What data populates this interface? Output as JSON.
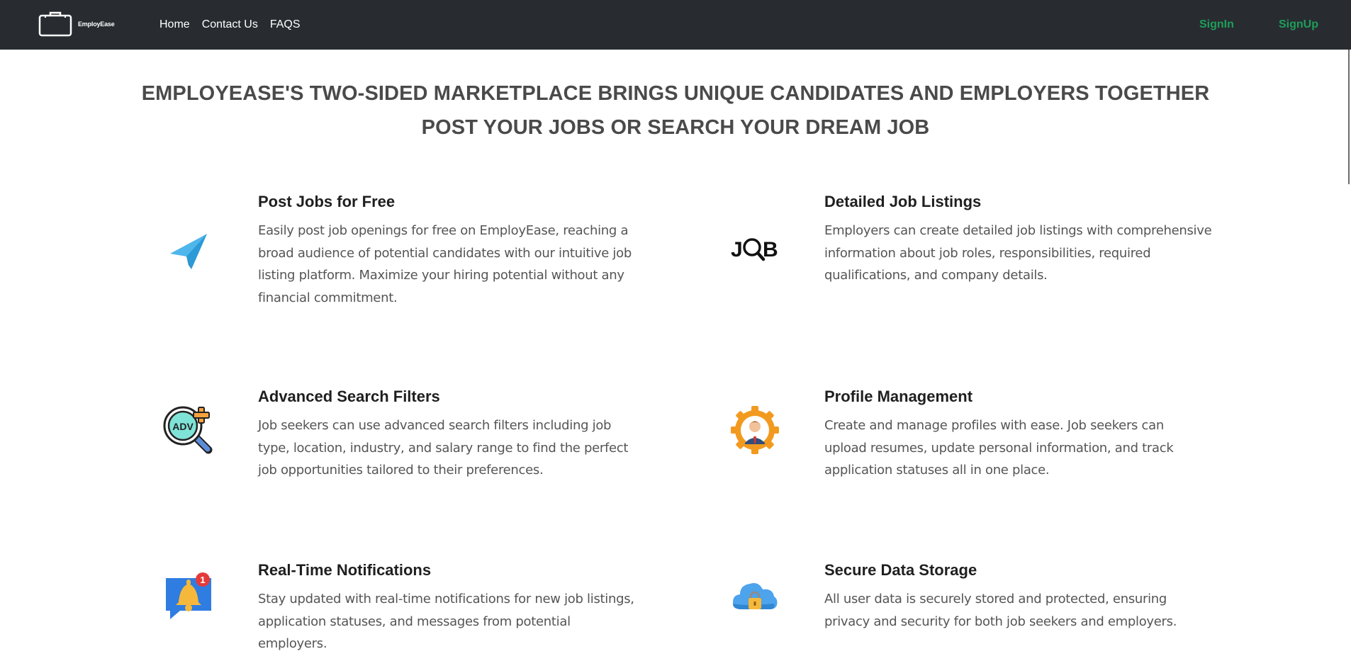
{
  "nav": {
    "brand": "EmployEase",
    "links": [
      "Home",
      "Contact Us",
      "FAQS"
    ],
    "signin": "SignIn",
    "signup": "SignUp"
  },
  "hero": {
    "line1": "EMPLOYEASE'S TWO-SIDED MARKETPLACE BRINGS UNIQUE CANDIDATES AND EMPLOYERS TOGETHER",
    "line2": "POST YOUR JOBS OR SEARCH YOUR DREAM JOB"
  },
  "features": [
    {
      "title": "Post Jobs for Free",
      "icon": "paper-plane-icon",
      "text": "Easily post job openings for free on EmployEase, reaching a broad audience of potential candidates with our intuitive job listing platform. Maximize your hiring potential without any financial commitment."
    },
    {
      "title": "Detailed Job Listings",
      "icon": "job-search-icon",
      "text": "Employers can create detailed job listings with comprehensive information about job roles, responsibilities, required qualifications, and company details."
    },
    {
      "title": "Advanced Search Filters",
      "icon": "advanced-search-icon",
      "text": "Job seekers can use advanced search filters including job type, location, industry, and salary range to find the perfect job opportunities tailored to their preferences."
    },
    {
      "title": "Profile Management",
      "icon": "profile-gear-icon",
      "text": "Create and manage profiles with ease. Job seekers can upload resumes, update personal information, and track application statuses all in one place."
    },
    {
      "title": "Real-Time Notifications",
      "icon": "notification-bell-icon",
      "badge": "1",
      "text": "Stay updated with real-time notifications for new job listings, application statuses, and messages from potential employers."
    },
    {
      "title": "Secure Data Storage",
      "icon": "cloud-lock-icon",
      "text": "All user data is securely stored and protected, ensuring privacy and security for both job seekers and employers."
    }
  ],
  "colors": {
    "navbar": "#282c31",
    "auth_link": "#1e9e5a",
    "heading": "#4a4a4a",
    "body_text": "#555555"
  }
}
